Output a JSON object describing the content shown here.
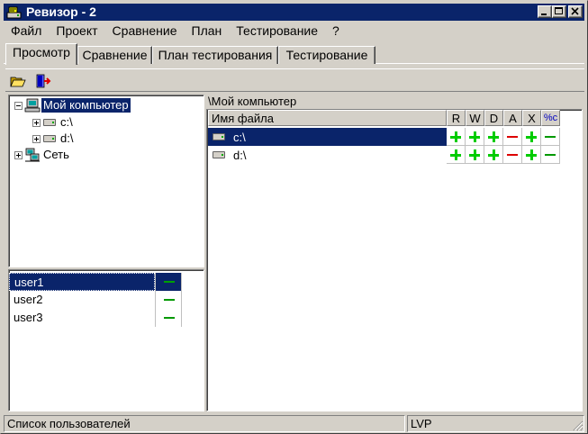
{
  "window": {
    "title": "Ревизор - 2"
  },
  "menu": [
    "Файл",
    "Проект",
    "Сравнение",
    "План",
    "Тестирование",
    "?"
  ],
  "tabs": [
    "Просмотр",
    "Сравнение",
    "План тестирования",
    "Тестирование"
  ],
  "active_tab": "Просмотр",
  "toolbar": {
    "buttons": [
      "open-folder-icon",
      "exit-door-icon"
    ]
  },
  "tree": {
    "root": "Мой компьютер",
    "drives": [
      "c:\\",
      "d:\\"
    ],
    "network": "Сеть"
  },
  "users": [
    {
      "name": "user1",
      "flag": "minus"
    },
    {
      "name": "user2",
      "flag": "minus"
    },
    {
      "name": "user3",
      "flag": "minus"
    }
  ],
  "path": "\\Мой компьютер",
  "grid": {
    "columns": [
      "Имя файла",
      "R",
      "W",
      "D",
      "A",
      "X",
      "%c"
    ],
    "rows": [
      {
        "name": "c:\\",
        "flags": [
          "+",
          "+",
          "+",
          "-",
          "+",
          "-"
        ]
      },
      {
        "name": "d:\\",
        "flags": [
          "+",
          "+",
          "+",
          "-",
          "+",
          "-"
        ]
      }
    ]
  },
  "colors": {
    "plus": "#00cc00",
    "minus_green": "#009900",
    "minus_red": "#dd0000",
    "selection": "#0a246a"
  },
  "status": {
    "left": "Список пользователей",
    "right": "LVP"
  }
}
